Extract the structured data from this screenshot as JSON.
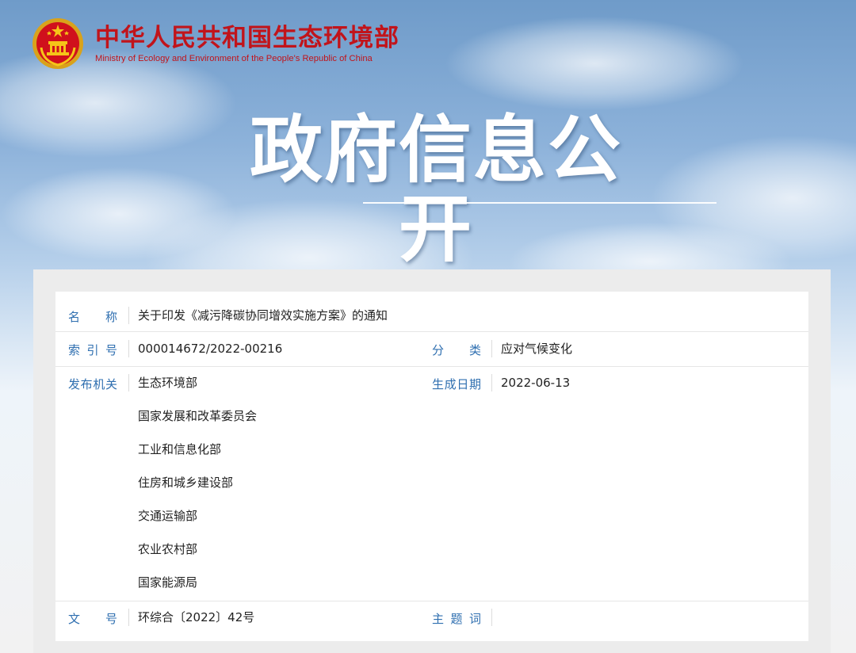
{
  "site": {
    "title": "中华人民共和国生态环境部",
    "subtitle": "Ministry of Ecology and Environment of the People's Republic of China",
    "emblem_icon": "national-emblem",
    "brand_color": "#c1141b"
  },
  "banner": {
    "title": "政府信息公开"
  },
  "info": {
    "name_label": "名　称",
    "name_value": "关于印发《减污降碳协同增效实施方案》的通知",
    "index_label": "索引号",
    "index_value": "000014672/2022-00216",
    "category_label": "分　类",
    "category_value": "应对气候变化",
    "issuer_label": "发布机关",
    "issuers": [
      "生态环境部",
      "国家发展和改革委员会",
      "工业和信息化部",
      "住房和城乡建设部",
      "交通运输部",
      "农业农村部",
      "国家能源局"
    ],
    "date_label": "生成日期",
    "date_value": "2022-06-13",
    "doc_no_label": "文　号",
    "doc_no_value": "环综合〔2022〕42号",
    "subject_label": "主题词",
    "subject_value": "",
    "label_color": "#2f6fb0"
  }
}
